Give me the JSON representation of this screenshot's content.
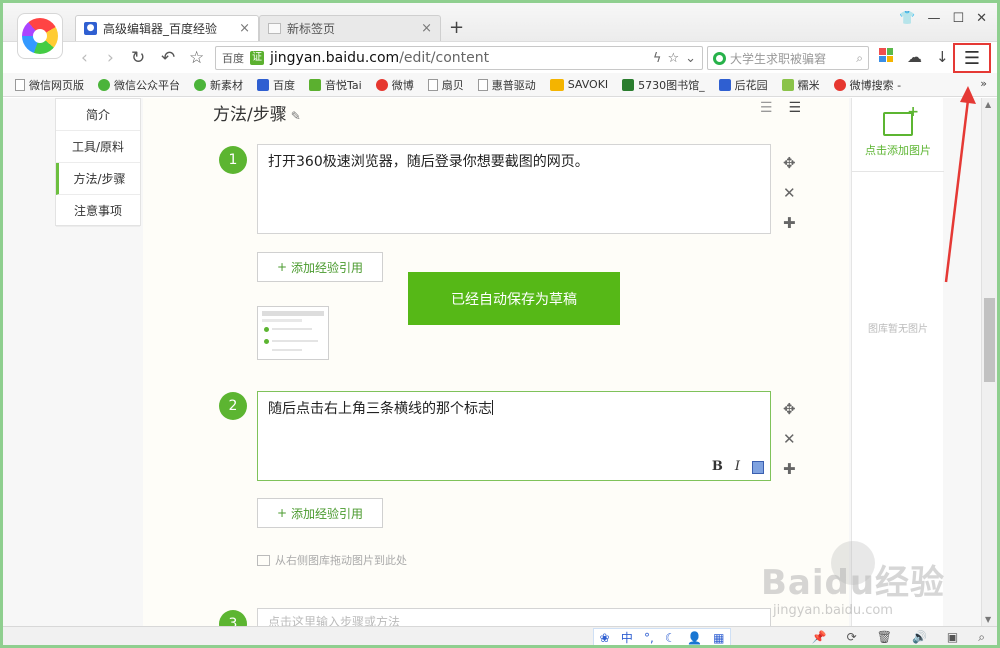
{
  "browser": {
    "tabs": [
      {
        "title": "高级编辑器_百度经验",
        "close": "×",
        "icon": "baidu-paw-icon"
      },
      {
        "title": "新标签页",
        "close": "×",
        "icon": "blank-page-icon"
      }
    ],
    "new_tab": "+",
    "window_controls": [
      "shirt-skin-icon",
      "minimize-icon",
      "maximize-icon",
      "close-icon"
    ],
    "address": {
      "site_tag": "百度",
      "cert_badge": "证",
      "url_host": "jingyan.baidu.com",
      "url_path": "/edit/content"
    },
    "search": {
      "placeholder": "大学生求职被骗窘"
    },
    "colors": {
      "accent_green": "#5cb531",
      "highlight_red": "#e53935",
      "frame_green": "#8fcf8f"
    }
  },
  "bookmarks": [
    {
      "label": "微信网页版",
      "icon": "doc"
    },
    {
      "label": "微信公众平台",
      "icon": "wx"
    },
    {
      "label": "新素材",
      "icon": "wx"
    },
    {
      "label": "百度",
      "icon": "paw"
    },
    {
      "label": "音悦Tai",
      "icon": "tai"
    },
    {
      "label": "微博",
      "icon": "wb"
    },
    {
      "label": "扇贝",
      "icon": "doc"
    },
    {
      "label": "惠普驱动",
      "icon": "doc"
    },
    {
      "label": "SAVOKI",
      "icon": "sav"
    },
    {
      "label": "5730图书馆_",
      "icon": "five"
    },
    {
      "label": "后花园",
      "icon": "paw"
    },
    {
      "label": "糯米",
      "icon": "nm"
    },
    {
      "label": "微博搜索 -",
      "icon": "wb"
    }
  ],
  "bookmarks_more": "»",
  "sidenav": [
    "简介",
    "工具/原料",
    "方法/步骤",
    "注意事项"
  ],
  "section": {
    "title": "方法/步骤"
  },
  "steps": [
    {
      "num": "1",
      "text": "打开360极速浏览器，随后登录你想要截图的网页。"
    },
    {
      "num": "2",
      "text": "随后点击右上角三条横线的那个标志"
    },
    {
      "num": "3",
      "text": "点击这里输入步骤或方法"
    }
  ],
  "ref_button": "添加经验引用",
  "ref_plus": "+",
  "toast": "已经自动保存为草稿",
  "drag_hint": "从右侧图库拖动图片到此处",
  "rte": {
    "bold": "B",
    "italic": "I"
  },
  "gallery": {
    "add_label": "点击添加图片",
    "empty_label": "图库暂无图片"
  },
  "ime": {
    "chinese": "中"
  },
  "watermark": {
    "main": "Baidu经验",
    "sub": "jingyan.baidu.com"
  }
}
